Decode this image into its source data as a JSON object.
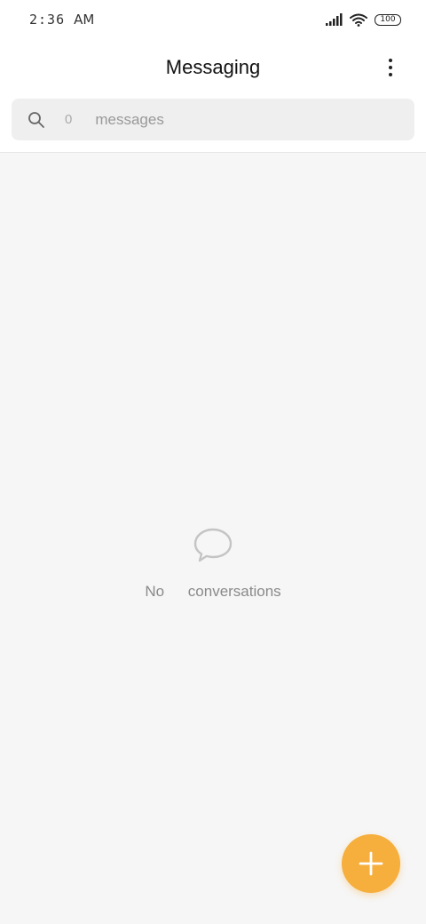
{
  "status_bar": {
    "time": "2:36",
    "ampm": "AM",
    "battery": "100",
    "icons": [
      "signal-icon",
      "wifi-icon",
      "battery-icon"
    ]
  },
  "header": {
    "title": "Messaging",
    "menu_icon": "more-vertical-icon"
  },
  "search": {
    "count": "0",
    "placeholder": "messages",
    "icon": "search-icon"
  },
  "empty_state": {
    "icon": "chat-bubble-icon",
    "text": "No conversations"
  },
  "fab": {
    "icon": "plus-icon",
    "color": "#f6ae3c"
  },
  "colors": {
    "accent": "#f6ae3c",
    "background": "#f6f6f6",
    "search_bg": "#efefef"
  }
}
